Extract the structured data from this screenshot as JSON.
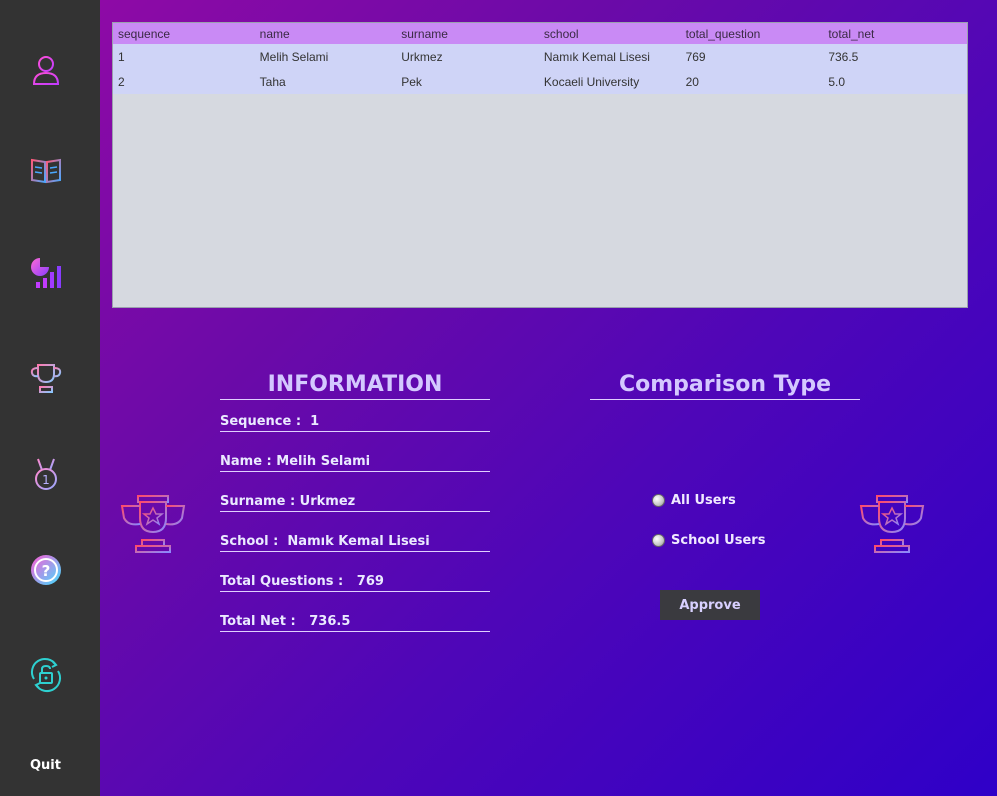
{
  "sidebar": {
    "icons": [
      "user-icon",
      "book-icon",
      "stats-icon",
      "trophy-icon",
      "medal-icon",
      "help-icon",
      "lock-icon"
    ],
    "quit_label": "Quit"
  },
  "table": {
    "headers": [
      "sequence",
      "name",
      "surname",
      "school",
      "total_question",
      "total_net"
    ],
    "rows": [
      [
        "1",
        "Melih Selami",
        "Urkmez",
        "Namık Kemal Lisesi",
        "769",
        "736.5"
      ],
      [
        "2",
        "Taha",
        "Pek",
        "Kocaeli University",
        "20",
        "5.0"
      ]
    ]
  },
  "information": {
    "title": "INFORMATION",
    "sequence": "Sequence :  1",
    "name": "Name : Melih Selami",
    "surname": "Surname : Urkmez",
    "school": "School :  Namık Kemal Lisesi",
    "total_questions": "Total Questions :   769",
    "total_net": "Total Net :   736.5"
  },
  "comparison": {
    "title": "Comparison Type",
    "options": [
      "All Users",
      "School Users"
    ],
    "approve_label": "Approve"
  },
  "colors": {
    "sidebar_bg": "#333333",
    "header_row": "#c98af5",
    "data_row": "#cfd4f7",
    "accent_pink": "#e23de8",
    "accent_cyan": "#3ee0e0"
  }
}
